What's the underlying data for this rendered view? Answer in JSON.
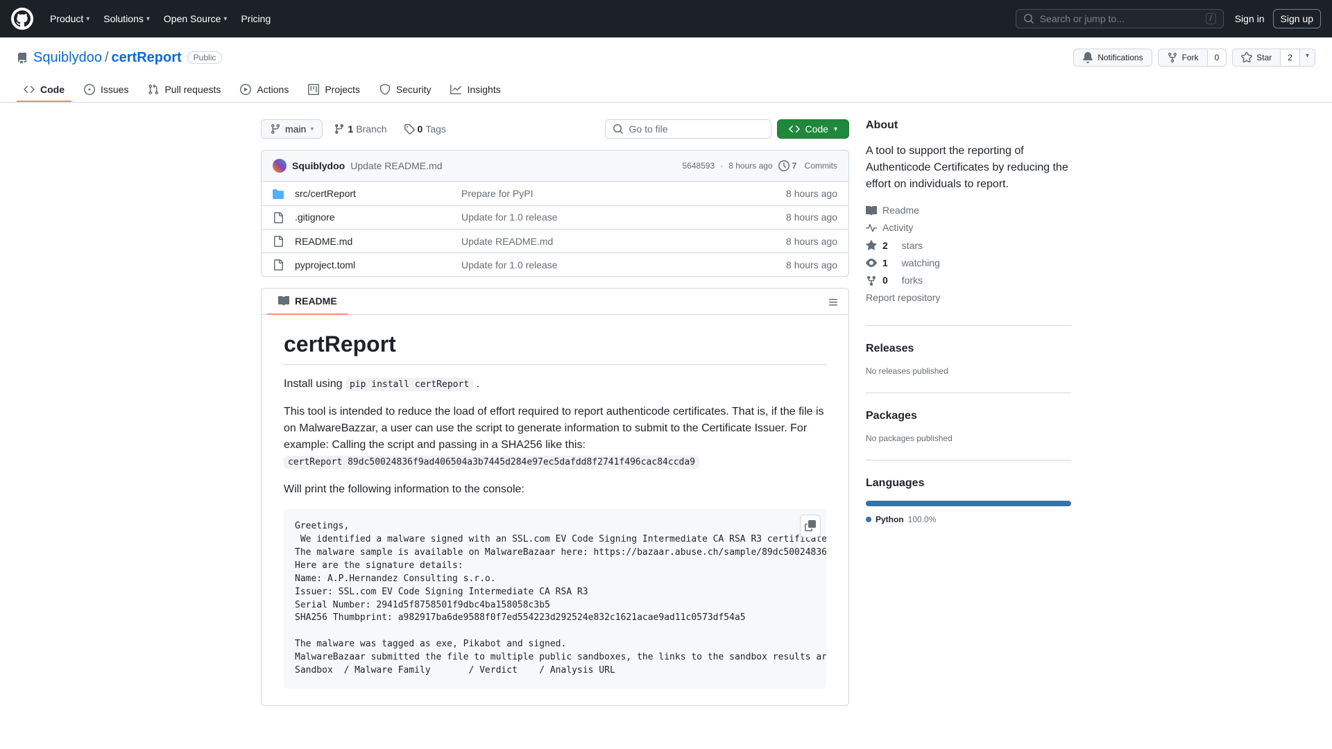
{
  "header": {
    "nav": [
      "Product",
      "Solutions",
      "Open Source",
      "Pricing"
    ],
    "search_placeholder": "Search or jump to...",
    "search_key": "/",
    "sign_in": "Sign in",
    "sign_up": "Sign up"
  },
  "repo": {
    "owner": "Squiblydoo",
    "name": "certReport",
    "visibility": "Public",
    "notifications_label": "Notifications",
    "fork_label": "Fork",
    "fork_count": "0",
    "star_label": "Star",
    "star_count": "2"
  },
  "repo_nav": [
    {
      "label": "Code",
      "active": true
    },
    {
      "label": "Issues"
    },
    {
      "label": "Pull requests"
    },
    {
      "label": "Actions"
    },
    {
      "label": "Projects"
    },
    {
      "label": "Security"
    },
    {
      "label": "Insights"
    }
  ],
  "toolbar": {
    "branch": "main",
    "branches_count": "1",
    "branches_label": "Branch",
    "tags_count": "0",
    "tags_label": "Tags",
    "goto_placeholder": "Go to file",
    "code_label": "Code"
  },
  "commit": {
    "author": "Squiblydoo",
    "message": "Update README.md",
    "sha": "5648593",
    "sep": "·",
    "time": "8 hours ago",
    "commits_count": "7",
    "commits_label": "Commits"
  },
  "files": [
    {
      "name": "src/certReport",
      "msg": "Prepare for PyPI",
      "time": "8 hours ago",
      "type": "folder"
    },
    {
      "name": ".gitignore",
      "msg": "Update for 1.0 release",
      "time": "8 hours ago",
      "type": "file"
    },
    {
      "name": "README.md",
      "msg": "Update README.md",
      "time": "8 hours ago",
      "type": "file"
    },
    {
      "name": "pyproject.toml",
      "msg": "Update for 1.0 release",
      "time": "8 hours ago",
      "type": "file"
    }
  ],
  "readme": {
    "tab_label": "README",
    "title": "certReport",
    "p1_before": "Install using",
    "p1_code": "pip install certReport",
    "p1_after": ".",
    "p2": "This tool is intended to reduce the load of effort required to report authenticode certificates. That is, if the file is on MalwareBazzar, a user can use the script to generate information to submit to the Certificate Issuer. For example: Calling the script and passing in a SHA256 like this:",
    "p2_code": "certReport 89dc50024836f9ad406504a3b7445d284e97ec5dafdd8f2741f496cac84ccda9",
    "p3": "Will print the following information to the console:",
    "pre": "Greetings,\n We identified a malware signed with an SSL.com EV Code Signing Intermediate CA RSA R3 certificate.\nThe malware sample is available on MalwareBazaar here: https://bazaar.abuse.ch/sample/89dc50024836f9ad406504a3b7445d284e97ec5dafdd8f2741f496cac84ccda9\nHere are the signature details:\nName: A.P.Hernandez Consulting s.r.o.\nIssuer: SSL.com EV Code Signing Intermediate CA RSA R3\nSerial Number: 2941d5f8758501f9dbc4ba158058c3b5\nSHA256 Thumbprint: a982917ba6de9588f0f7ed554223d292524e832c1621acae9ad11c0573df54a5\n\nThe malware was tagged as exe, Pikabot and signed.\nMalwareBazaar submitted the file to multiple public sandboxes, the links to the sandbox results are below:\nSandbox  / Malware Family       / Verdict    / Analysis URL"
  },
  "about": {
    "heading": "About",
    "description": "A tool to support the reporting of Authenticode Certificates by reducing the effort on individuals to report.",
    "links": {
      "readme": "Readme",
      "activity": "Activity",
      "stars_n": "2",
      "stars_l": "stars",
      "watching_n": "1",
      "watching_l": "watching",
      "forks_n": "0",
      "forks_l": "forks",
      "report": "Report repository"
    }
  },
  "releases": {
    "heading": "Releases",
    "none": "No releases published"
  },
  "packages": {
    "heading": "Packages",
    "none": "No packages published"
  },
  "languages": {
    "heading": "Languages",
    "item_name": "Python",
    "item_pct": "100.0%"
  }
}
